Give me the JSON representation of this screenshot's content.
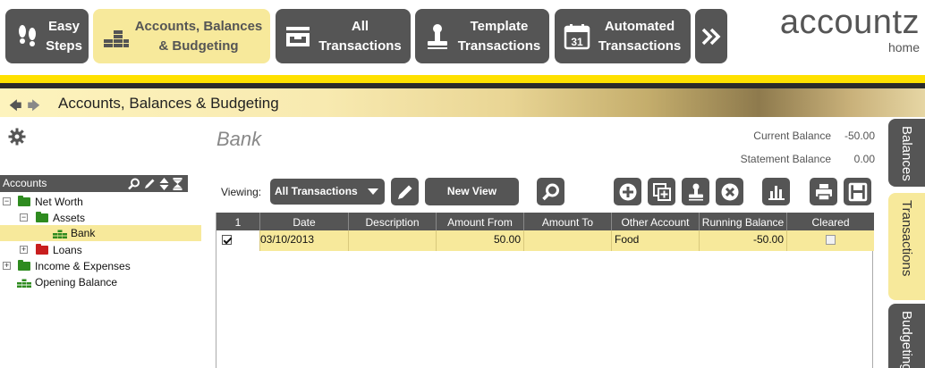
{
  "nav": {
    "items": [
      {
        "label": "Easy\nSteps",
        "icon": "footprints-icon"
      },
      {
        "label": "Accounts, Balances\n& Budgeting",
        "icon": "coins-stack-icon",
        "active": true
      },
      {
        "label": "All\nTransactions",
        "icon": "inbox-tray-icon"
      },
      {
        "label": "Template\nTransactions",
        "icon": "stamp-icon"
      },
      {
        "label": "Automated\nTransactions",
        "icon": "calendar-31-icon"
      }
    ],
    "more_icon": "double-chevron-right-icon"
  },
  "logo": {
    "brand": "accountz",
    "sub": "home"
  },
  "banner": {
    "title": "Accounts, Balances & Budgeting"
  },
  "sidebar": {
    "settings_icon": "gear-icon",
    "accounts_header": "Accounts",
    "tree": [
      {
        "label": "Net Worth",
        "expander": "⊟",
        "icon": "green-folder"
      },
      {
        "label": "Assets",
        "expander": "⊟",
        "icon": "green-folder"
      },
      {
        "label": "Bank",
        "expander": "",
        "icon": "coins-icon",
        "selected": true
      },
      {
        "label": "Loans",
        "expander": "⊞",
        "icon": "red-folder"
      },
      {
        "label": "Income & Expenses",
        "expander": "⊞",
        "icon": "green-folder"
      },
      {
        "label": "Opening Balance",
        "expander": "",
        "icon": "coins-icon"
      }
    ]
  },
  "main": {
    "title": "Bank",
    "current_balance_label": "Current Balance",
    "current_balance_value": "-50.00",
    "statement_balance_label": "Statement Balance",
    "statement_balance_value": "0.00",
    "viewing_label": "Viewing:",
    "view_selected": "All Transactions",
    "new_view_label": "New View"
  },
  "table": {
    "columns": [
      "1",
      "Date",
      "Description",
      "Amount From",
      "Amount To",
      "Other Account",
      "Running Balance",
      "Cleared"
    ],
    "rows": [
      {
        "checked": true,
        "date": "03/10/2013",
        "description": "",
        "amount_from": "50.00",
        "amount_to": "",
        "other_account": "Food",
        "running_balance": "-50.00",
        "cleared": false
      }
    ]
  },
  "right_tabs": [
    "Balances",
    "Transactions",
    "Budgeting"
  ],
  "colors": {
    "nav_bg": "#555555",
    "accent_yellow": "#f7e99b",
    "bar_yellow": "#ffe100",
    "folder_green": "#2e8b1f",
    "folder_red": "#c81e1e"
  }
}
